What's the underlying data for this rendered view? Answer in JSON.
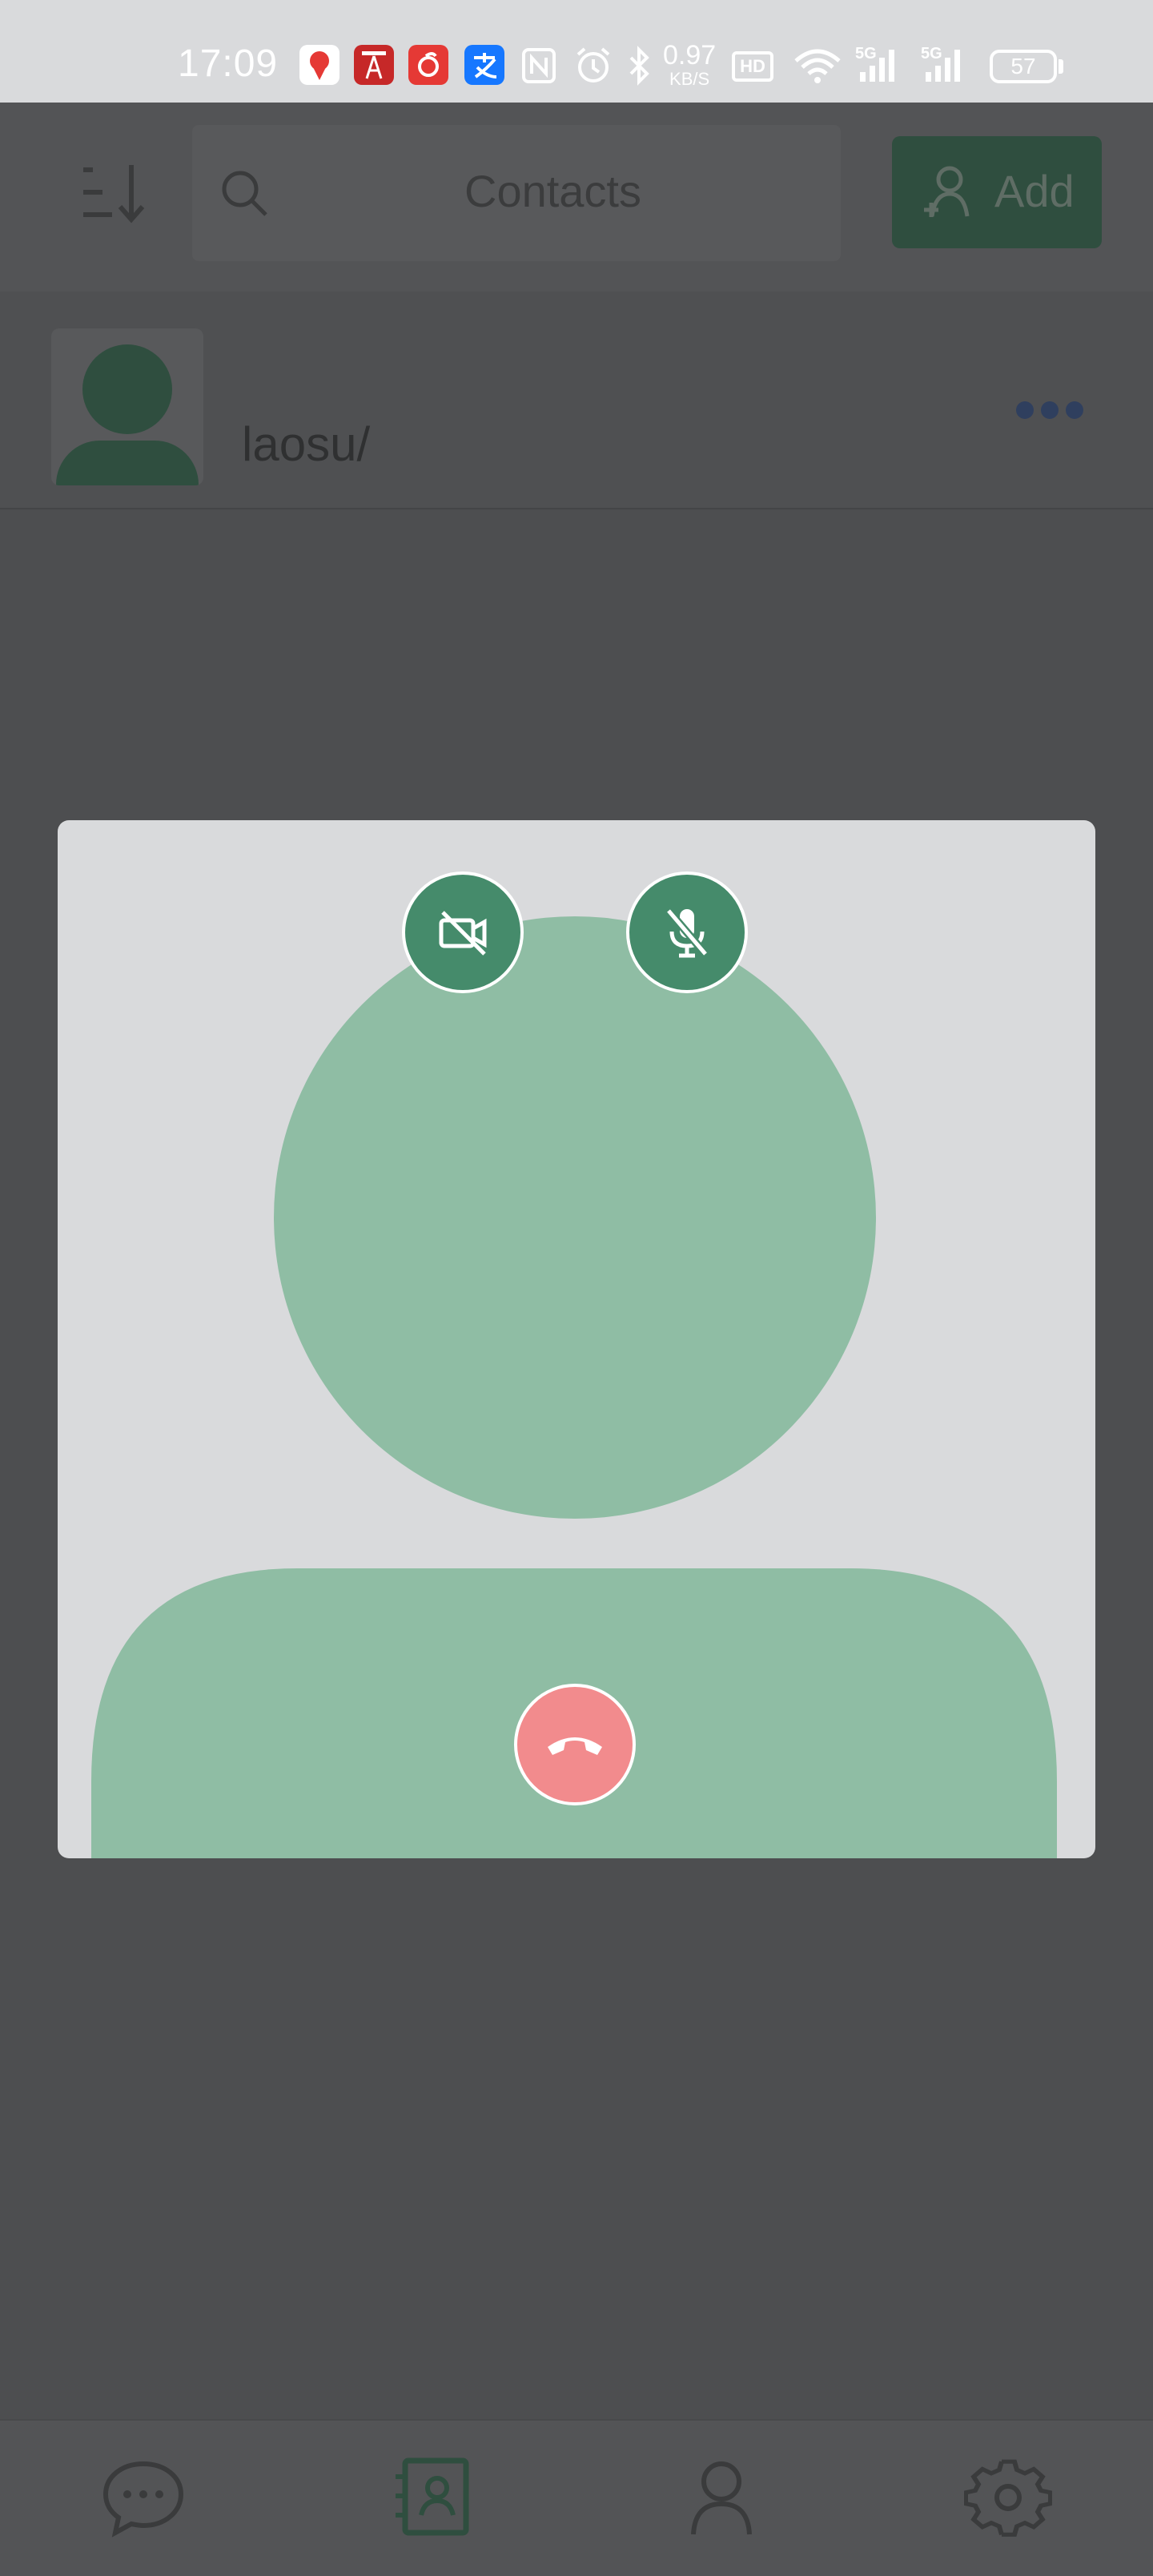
{
  "status_bar": {
    "time": "17:09",
    "net_speed": "0.97",
    "net_speed_unit": "KB/S",
    "hd_badge": "HD",
    "signal_1_label": "5G",
    "signal_2_label": "5G",
    "battery": "57"
  },
  "header": {
    "search_label": "Contacts",
    "add_label": "Add"
  },
  "contacts": [
    {
      "name": "laosu/"
    }
  ],
  "tab_bar": {
    "items": [
      "chats-icon",
      "contacts-icon",
      "profile-icon",
      "settings-icon"
    ]
  },
  "call": {
    "accent_color": "#458b6b",
    "avatar_color": "#8fbda4",
    "hangup_color": "#f28b8d"
  }
}
